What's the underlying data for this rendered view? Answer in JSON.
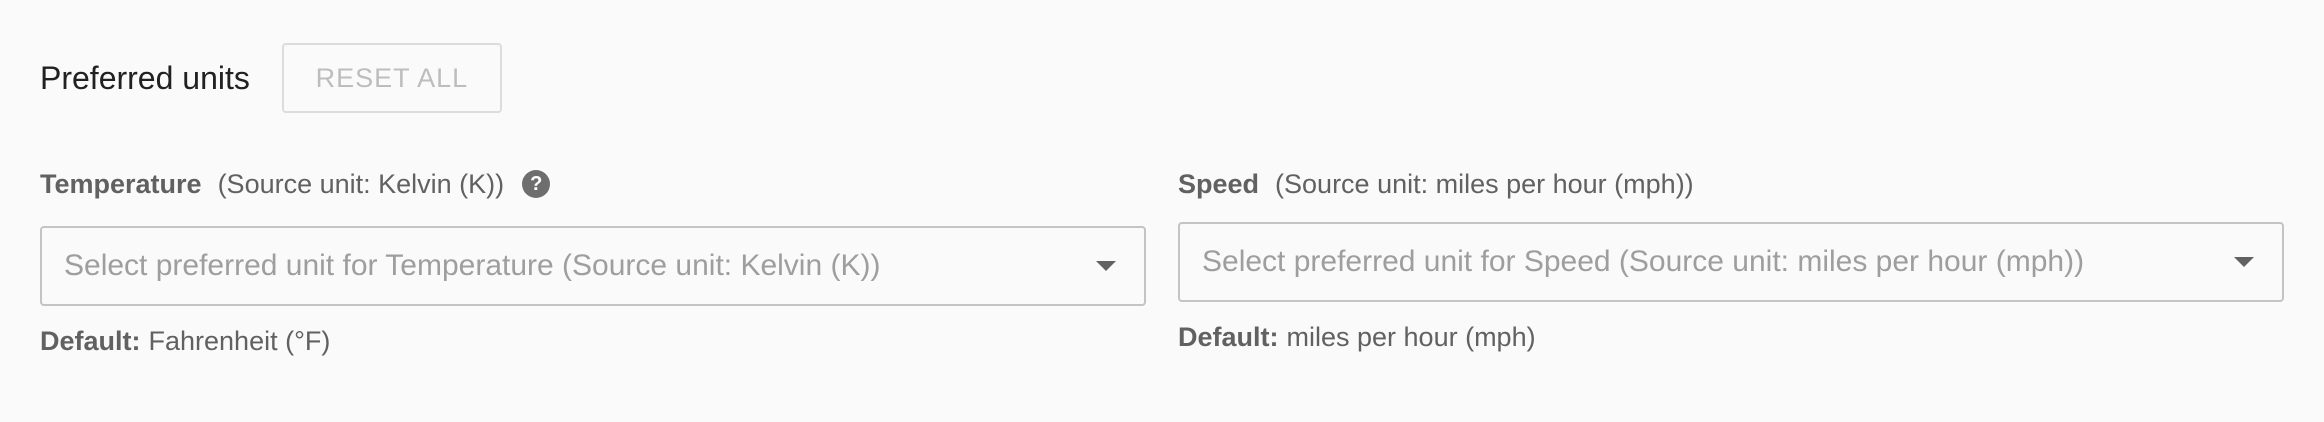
{
  "header": {
    "title": "Preferred units",
    "reset_label": "RESET ALL"
  },
  "fields": [
    {
      "label": "Temperature",
      "source_unit": "(Source unit: Kelvin (K))",
      "help_icon": "question-circle-icon",
      "placeholder": "Select preferred unit for Temperature (Source unit: Kelvin (K))",
      "default_label": "Default:",
      "default_value": "Fahrenheit (°F)"
    },
    {
      "label": "Speed",
      "source_unit": "(Source unit: miles per hour (mph))",
      "placeholder": "Select preferred unit for Speed (Source unit: miles per hour (mph))",
      "default_label": "Default:",
      "default_value": "miles per hour (mph)"
    }
  ],
  "colors": {
    "background": "#fafafa",
    "text_primary": "#212121",
    "text_secondary": "#616161",
    "placeholder": "#9e9e9e",
    "border": "#c4c4c4",
    "disabled": "#bdbdbd"
  }
}
